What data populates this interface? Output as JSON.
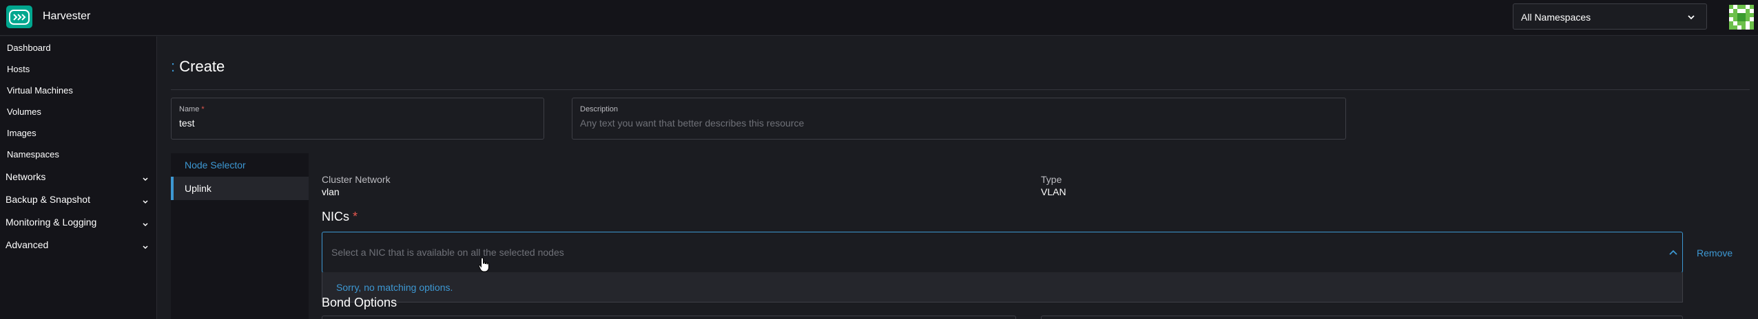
{
  "header": {
    "app_title": "Harvester",
    "namespace_select": {
      "value": "All Namespaces",
      "icon": "chevron-down-icon"
    },
    "logo_icon": "harvester-logo-icon",
    "avatar_icon": "user-avatar-icon"
  },
  "sidebar": {
    "items": [
      {
        "label": "Dashboard"
      },
      {
        "label": "Hosts"
      },
      {
        "label": "Virtual Machines"
      },
      {
        "label": "Volumes"
      },
      {
        "label": "Images"
      },
      {
        "label": "Namespaces"
      }
    ],
    "groups": [
      {
        "label": "Networks",
        "icon": "chevron-down-icon"
      },
      {
        "label": "Backup & Snapshot",
        "icon": "chevron-down-icon"
      },
      {
        "label": "Monitoring & Logging",
        "icon": "chevron-down-icon"
      },
      {
        "label": "Advanced",
        "icon": "chevron-down-icon"
      }
    ]
  },
  "main": {
    "title_prefix": ":",
    "title": "Create",
    "name_field": {
      "label": "Name",
      "required_mark": "*",
      "value": "test"
    },
    "description_field": {
      "label": "Description",
      "placeholder": "Any text you want that better describes this resource"
    },
    "tabs": [
      {
        "label": "Node Selector"
      },
      {
        "label": "Uplink"
      }
    ],
    "cluster_network": {
      "label": "Cluster Network",
      "value": "vlan"
    },
    "type": {
      "label": "Type",
      "value": "VLAN"
    },
    "nics": {
      "title": "NICs",
      "required_mark": "*",
      "placeholder": "Select a NIC that is available on all the selected nodes",
      "no_options": "Sorry, no matching options.",
      "icon": "chevron-up-icon"
    },
    "remove_label": "Remove",
    "bond_options_title": "Bond Options"
  },
  "colors": {
    "accent": "#3d98d3",
    "brand": "#00a78f",
    "required": "#e5584f",
    "background": "#1b1c21",
    "sidebar_bg": "#141419"
  }
}
